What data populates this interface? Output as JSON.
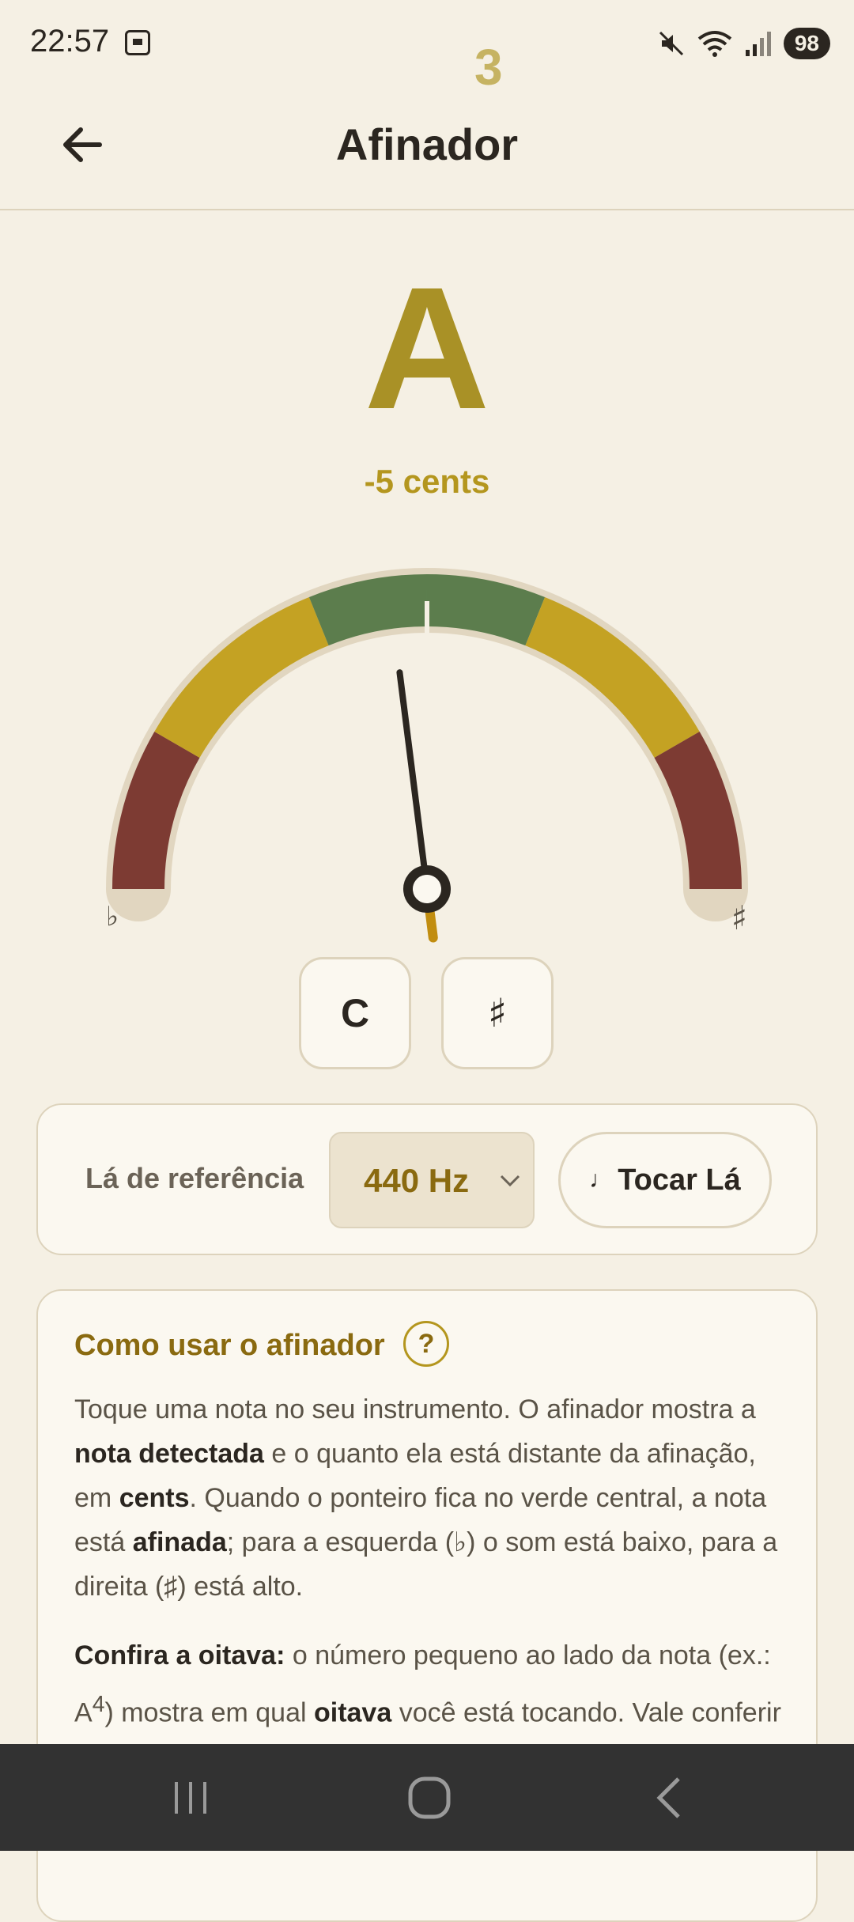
{
  "status": {
    "time": "22:57",
    "battery": "98"
  },
  "appbar": {
    "title": "Afinador"
  },
  "tuner": {
    "note": "A",
    "octave": "3",
    "cents_text": "-5 cents",
    "cents": -5,
    "flat_symbol": "♭",
    "sharp_symbol": "♯"
  },
  "notation_buttons": {
    "letter_label": "C",
    "accidental_label": "♯"
  },
  "reference": {
    "label": "Lá de referência",
    "value": "440 Hz",
    "play_label": "Tocar Lá",
    "play_icon": "♩"
  },
  "help": {
    "title": "Como usar o afinador",
    "question_icon": "?",
    "p1": {
      "a": "Toque uma nota no seu instrumento. O afinador mostra a ",
      "b": "nota detectada",
      "c": " e o quanto ela está distante da afinação, em ",
      "d": "cents",
      "e": ". Quando o ponteiro fica no verde central, a nota está ",
      "f": "afinada",
      "g": "; para a esquerda (♭) o som está baixo, para a direita (♯) está alto."
    },
    "p2": {
      "a": "Confira a oitava:",
      "b": " o número pequeno ao lado da nota (ex.: A",
      "sup": "4",
      "c": ") mostra em qual ",
      "d": "oitava",
      "e": " você está tocando. Vale conferir sempre — é fácil, sem perceber, afinar uma"
    }
  },
  "colors": {
    "background": "#f5f0e4",
    "note": "#a99126",
    "green": "#5c7d4d",
    "yellow": "#c4a223",
    "red": "#7d3b33",
    "accent": "#8a6a10"
  }
}
